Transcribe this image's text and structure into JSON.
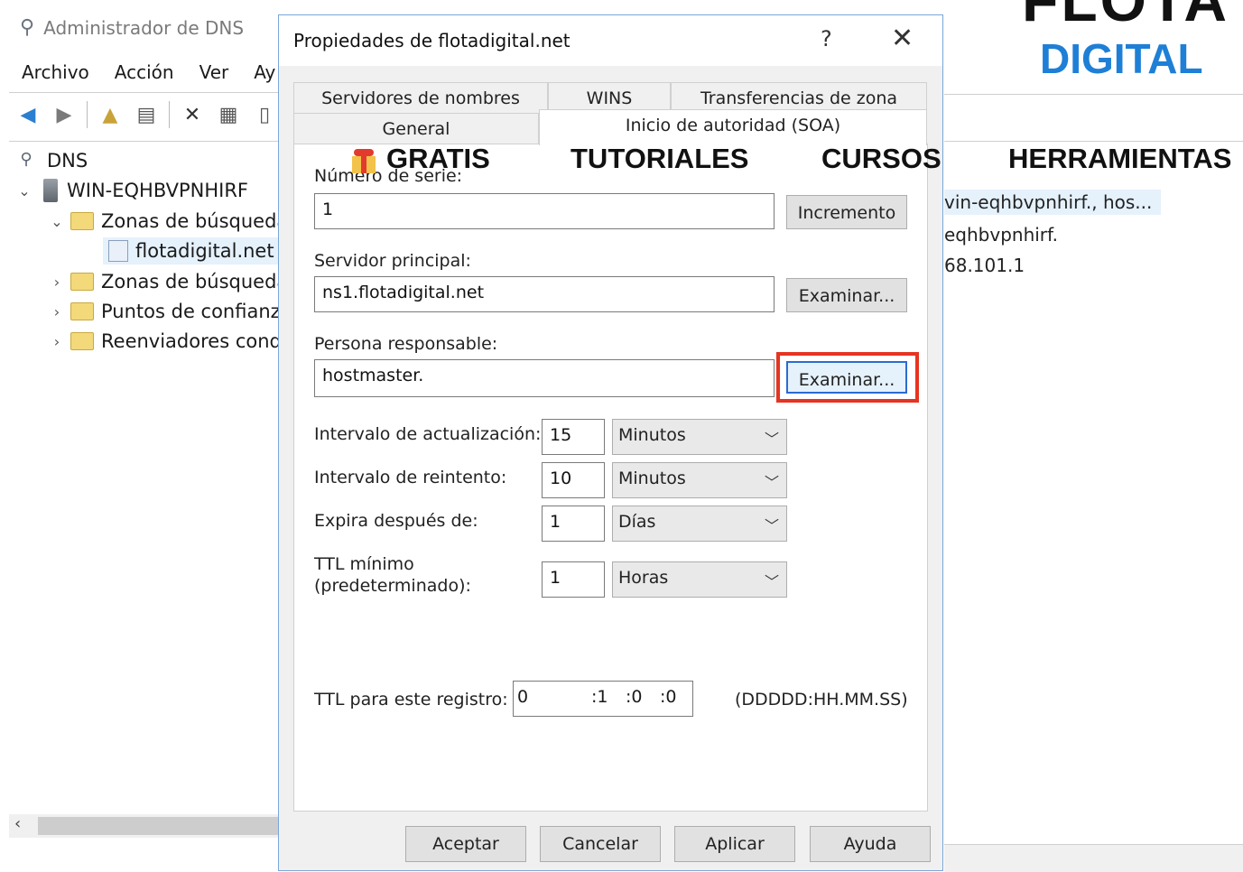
{
  "mmc": {
    "title": "Administrador de DNS",
    "menu": [
      "Archivo",
      "Acción",
      "Ver",
      "Ay"
    ],
    "tree": {
      "root": "DNS",
      "server": "WIN-EQHBVPNHIRF",
      "forward_zones": "Zonas de búsqueda",
      "zone": "flotadigital.net",
      "reverse_zones": "Zonas de búsqueda",
      "trust_points": "Puntos de confianza",
      "forwarders": "Reenviadores cond"
    },
    "right_list": [
      "vin-eqhbvpnhirf., hos...",
      "eqhbvpnhirf.",
      "68.101.1"
    ]
  },
  "overlay": {
    "logo_line1": "FLOTA",
    "logo_line2": "DIGITAL",
    "nav": [
      "GRATIS",
      "TUTORIALES",
      "CURSOS",
      "HERRAMIENTAS"
    ]
  },
  "dialog": {
    "title": "Propiedades de flotadigital.net",
    "help": "?",
    "close": "✕",
    "tabs_row1": [
      "Servidores de nombres",
      "WINS",
      "Transferencias de zona"
    ],
    "tabs_row2": [
      "General",
      "Inicio de autoridad (SOA)"
    ],
    "serial_label": "Número de serie:",
    "serial_value": "1",
    "increment_button": "Incremento",
    "primary_server_label": "Servidor principal:",
    "primary_server_value": "ns1.flotadigital.net",
    "browse_button_1": "Examinar...",
    "responsible_label": "Persona responsable:",
    "responsible_value": "hostmaster.",
    "browse_button_2": "Examinar...",
    "refresh_label": "Intervalo de actualización:",
    "refresh_value": "15",
    "refresh_unit": "Minutos",
    "retry_label": "Intervalo de reintento:",
    "retry_value": "10",
    "retry_unit": "Minutos",
    "expire_label": "Expira después de:",
    "expire_value": "1",
    "expire_unit": "Días",
    "min_ttl_label_1": "TTL mínimo",
    "min_ttl_label_2": "(predeterminado):",
    "min_ttl_value": "1",
    "min_ttl_unit": "Horas",
    "record_ttl_label": "TTL para este registro:",
    "record_ttl_days": "0",
    "record_ttl_hours": ":1",
    "record_ttl_minutes": ":0",
    "record_ttl_seconds": ":0",
    "record_ttl_format": "(DDDDD:HH.MM.SS)",
    "ok_button": "Aceptar",
    "cancel_button": "Cancelar",
    "apply_button": "Aplicar",
    "help_button": "Ayuda"
  },
  "colors": {
    "highlight": "#e53421",
    "logo_blue": "#1e7fd6",
    "focus_border": "#2a6bd1"
  }
}
